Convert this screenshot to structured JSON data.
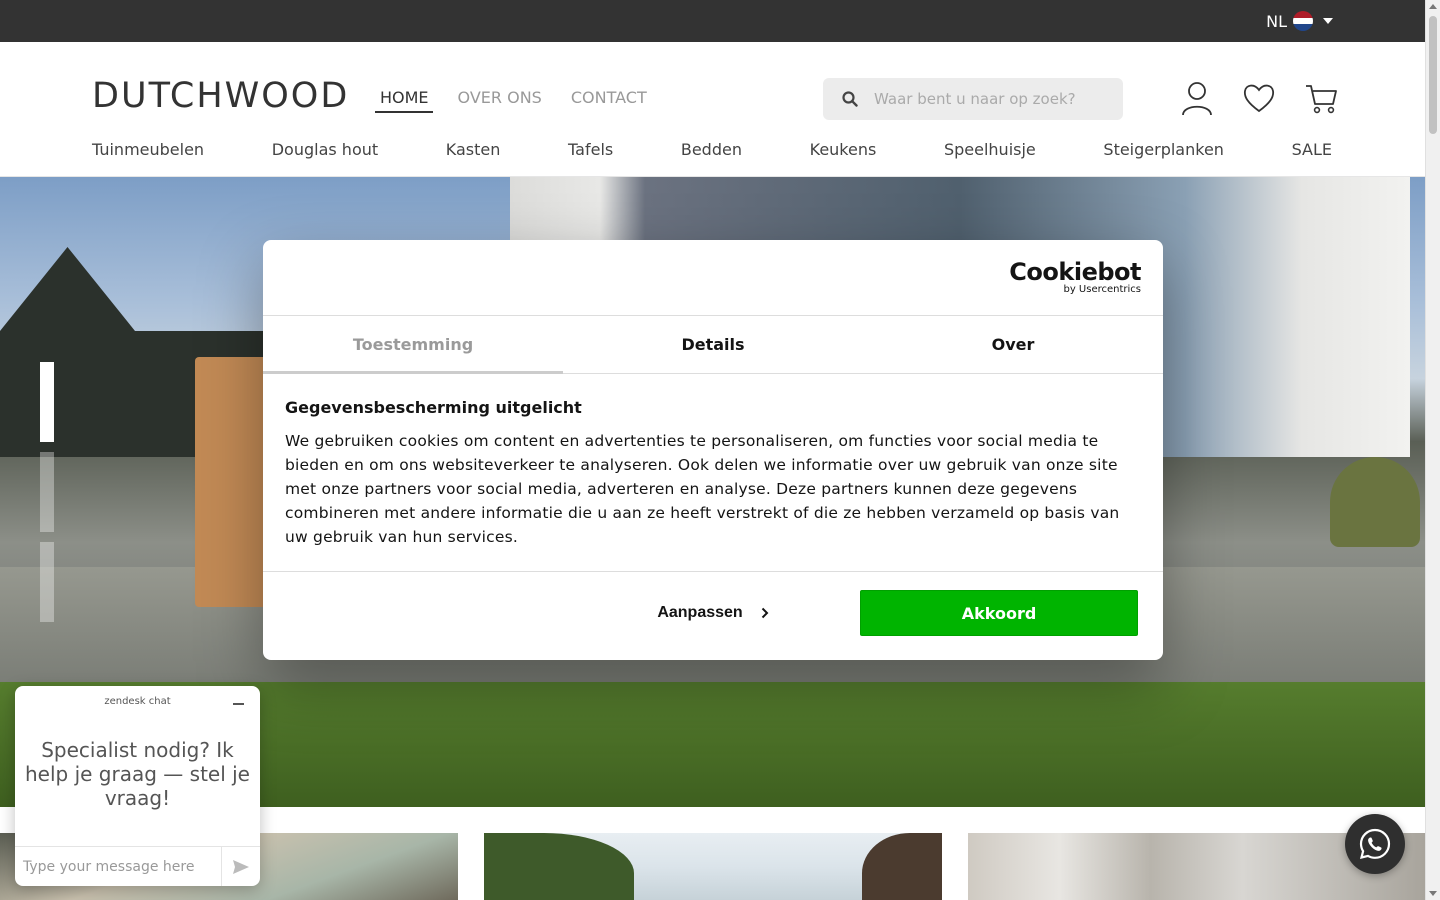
{
  "topbar": {
    "language": "NL",
    "flag_colors": [
      "#ae1c28",
      "#ffffff",
      "#21468b"
    ]
  },
  "header": {
    "logo": "DUTCHWOOD",
    "nav": [
      {
        "label": "HOME",
        "active": true
      },
      {
        "label": "OVER ONS",
        "active": false
      },
      {
        "label": "CONTACT",
        "active": false
      }
    ],
    "search_placeholder": "Waar bent u naar op zoek?",
    "icons": [
      "user-icon",
      "heart-icon",
      "cart-icon"
    ]
  },
  "categories": [
    "Tuinmeubelen",
    "Douglas hout",
    "Kasten",
    "Tafels",
    "Bedden",
    "Keukens",
    "Speelhuisje",
    "Steigerplanken",
    "SALE"
  ],
  "hero": {
    "slides_count": 3,
    "active_slide": 1
  },
  "cookie": {
    "brand": "Cookiebot",
    "brand_sub": "by Usercentrics",
    "tabs": [
      {
        "label": "Toestemming",
        "active": true
      },
      {
        "label": "Details",
        "active": false
      },
      {
        "label": "Over",
        "active": false
      }
    ],
    "heading": "Gegevensbescherming uitgelicht",
    "body": "We gebruiken cookies om content en advertenties te personaliseren, om functies voor social media te bieden en om ons websiteverkeer te analyseren. Ook delen we informatie over uw gebruik van onze site met onze partners voor social media, adverteren en analyse. Deze partners kunnen deze gegevens combineren met andere informatie die u aan ze heeft verstrekt of die ze hebben verzameld op basis van uw gebruik van hun services.",
    "adjust_label": "Aanpassen",
    "accept_label": "Akkoord",
    "accept_color": "#00b400"
  },
  "chat": {
    "brand": "zendesk chat",
    "message": "Specialist nodig? Ik help je graag — stel je vraag!",
    "input_placeholder": "Type your message here"
  },
  "whatsapp": {
    "icon": "whatsapp-icon"
  }
}
